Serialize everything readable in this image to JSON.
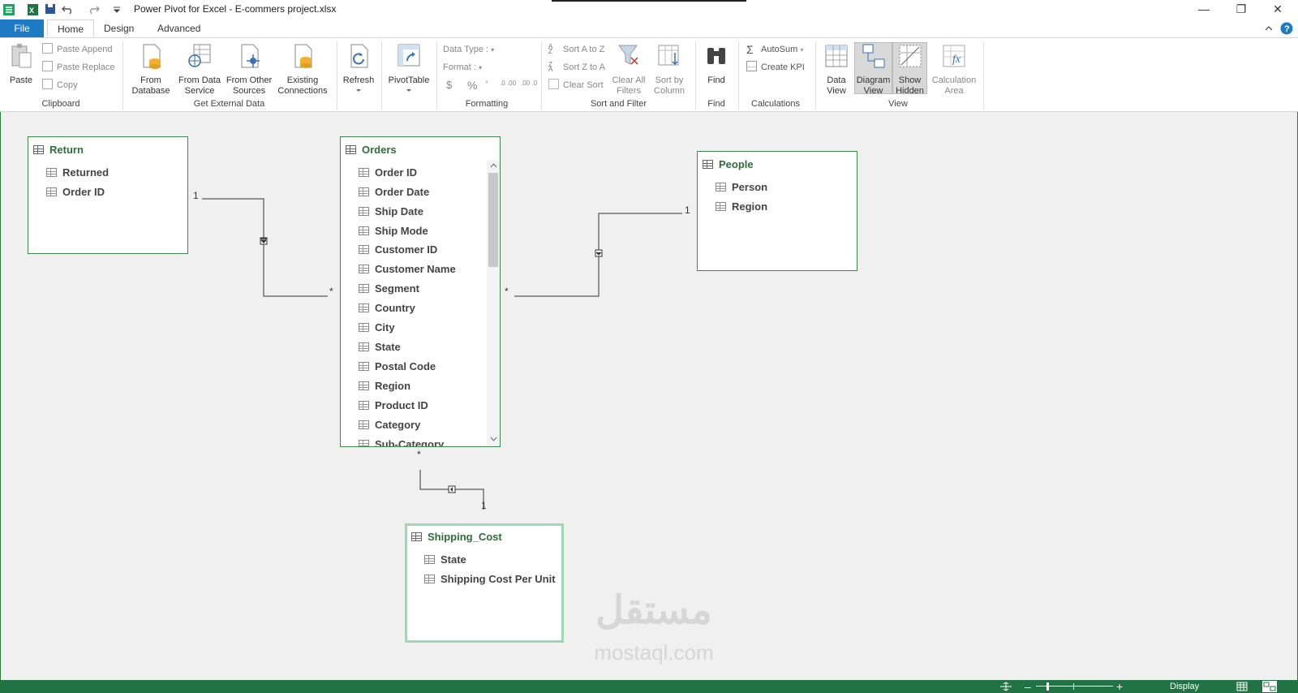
{
  "window": {
    "title": "Power Pivot for Excel - E-commers project.xlsx",
    "minimize_glyph": "—",
    "restore_glyph": "❐",
    "close_glyph": "✕"
  },
  "tabs": {
    "file": "File",
    "home": "Home",
    "design": "Design",
    "advanced": "Advanced"
  },
  "ribbon": {
    "clipboard": {
      "paste": "Paste",
      "paste_append": "Paste Append",
      "paste_replace": "Paste Replace",
      "copy": "Copy",
      "label": "Clipboard"
    },
    "external": {
      "from_database_1": "From",
      "from_database_2": "Database",
      "from_data_service_1": "From Data",
      "from_data_service_2": "Service",
      "from_other_1": "From Other",
      "from_other_2": "Sources",
      "existing_1": "Existing",
      "existing_2": "Connections",
      "label": "Get External Data"
    },
    "refresh": "Refresh",
    "pivottable": "PivotTable",
    "formatting": {
      "data_type": "Data Type :",
      "format": "Format :",
      "dollar": "$",
      "percent": "%",
      "comma": "̓",
      "inc": ".0 .00",
      "dec": ".00 .0",
      "label": "Formatting"
    },
    "sort": {
      "sort_az": "Sort A to Z",
      "sort_za": "Sort Z to A",
      "clear_sort": "Clear Sort",
      "clear_filters_1": "Clear All",
      "clear_filters_2": "Filters",
      "sort_by_col_1": "Sort by",
      "sort_by_col_2": "Column",
      "label": "Sort and Filter"
    },
    "find": {
      "find": "Find",
      "label": "Find"
    },
    "calculations": {
      "autosum": "AutoSum",
      "create_kpi": "Create KPI",
      "label": "Calculations"
    },
    "view": {
      "data_view_1": "Data",
      "data_view_2": "View",
      "diagram_view_1": "Diagram",
      "diagram_view_2": "View",
      "show_hidden_1": "Show",
      "show_hidden_2": "Hidden",
      "calc_area_1": "Calculation",
      "calc_area_2": "Area",
      "label": "View"
    }
  },
  "tables": {
    "return": {
      "name": "Return",
      "columns": [
        "Returned",
        "Order ID"
      ]
    },
    "orders": {
      "name": "Orders",
      "columns": [
        "Order ID",
        "Order Date",
        "Ship Date",
        "Ship Mode",
        "Customer ID",
        "Customer Name",
        "Segment",
        "Country",
        "City",
        "State",
        "Postal Code",
        "Region",
        "Product ID",
        "Category",
        "Sub-Category"
      ]
    },
    "people": {
      "name": "People",
      "columns": [
        "Person",
        "Region"
      ]
    },
    "shipping_cost": {
      "name": "Shipping_Cost",
      "columns": [
        "State",
        "Shipping Cost Per Unit"
      ]
    }
  },
  "relationships": {
    "one": "1",
    "many": "*"
  },
  "watermark": {
    "arabic": "مستقل",
    "latin": "mostaql.com"
  },
  "statusbar": {
    "display": "Display"
  },
  "colors": {
    "file_tab": "#1f7ac4",
    "status_bar": "#217346",
    "table_border": "#3a8a4a",
    "table_title": "#2f6e3a"
  }
}
